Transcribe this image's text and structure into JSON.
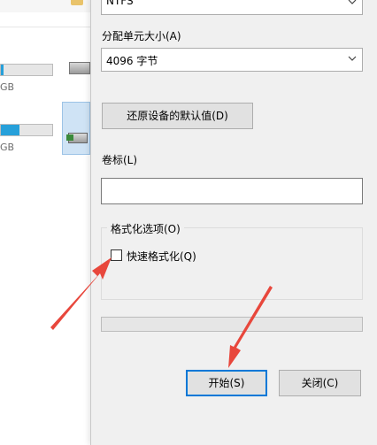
{
  "background": {
    "drives": [
      {
        "size_suffix": "GB",
        "fill_fraction": 0.05,
        "fill_color": "#26a0da"
      },
      {
        "size_suffix": "GB",
        "fill_fraction": 0.35,
        "fill_color": "#26a0da"
      }
    ]
  },
  "dialog": {
    "filesystem_value": "NTFS",
    "allocation_label": "分配单元大小(A)",
    "allocation_value": "4096 字节",
    "restore_defaults_button": "还原设备的默认值(D)",
    "volume_label": "卷标(L)",
    "volume_value": "",
    "format_options_title": "格式化选项(O)",
    "quick_format_label": "快速格式化(Q)",
    "quick_format_checked": false,
    "progress_fraction": 0,
    "start_button": "开始(S)",
    "close_button": "关闭(C)"
  },
  "colors": {
    "annotation_arrow": "#e8473c",
    "primary_border": "#0078d7"
  }
}
